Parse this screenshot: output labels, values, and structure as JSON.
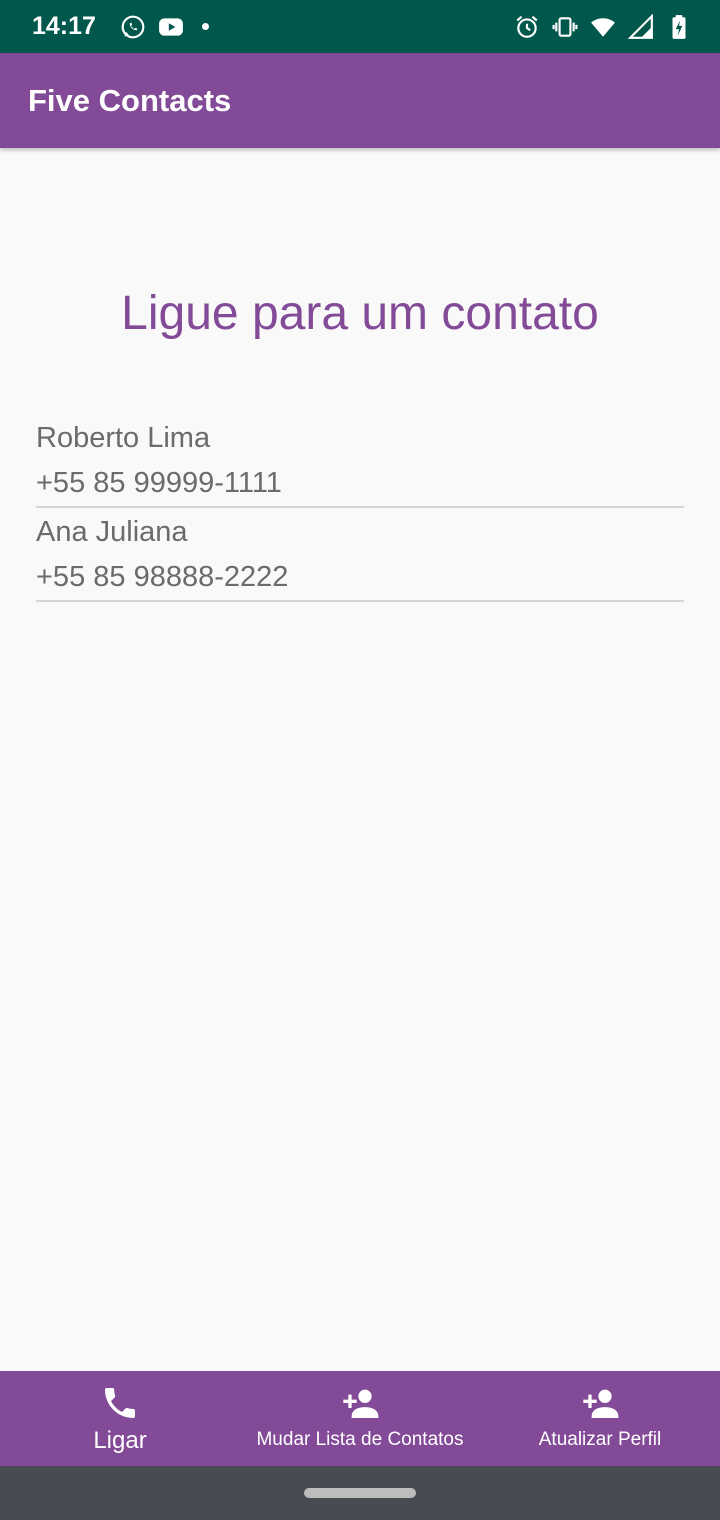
{
  "status_bar": {
    "time": "14:17",
    "left_icons": [
      "whatsapp-icon",
      "youtube-icon",
      "notification-dot-icon"
    ],
    "right_icons": [
      "alarm-icon",
      "vibrate-icon",
      "wifi-icon",
      "signal-icon",
      "battery-charging-icon"
    ]
  },
  "app_bar": {
    "title": "Five Contacts"
  },
  "main": {
    "heading": "Ligue para um contato",
    "contacts": [
      {
        "name": "Roberto Lima",
        "phone": "+55 85 99999-1111"
      },
      {
        "name": "Ana Juliana",
        "phone": "+55 85 98888-2222"
      }
    ]
  },
  "bottom_nav": {
    "items": [
      {
        "label": "Ligar",
        "icon": "phone-icon",
        "active": true
      },
      {
        "label": "Mudar Lista de Contatos",
        "icon": "person-add-icon",
        "active": false
      },
      {
        "label": "Atualizar Perfil",
        "icon": "person-add-icon",
        "active": false
      }
    ]
  },
  "colors": {
    "status_bar": "#00574b",
    "primary": "#824a97",
    "background": "#f9f9f9",
    "contact_text": "#6b6b6b",
    "system_nav": "#474b52"
  }
}
